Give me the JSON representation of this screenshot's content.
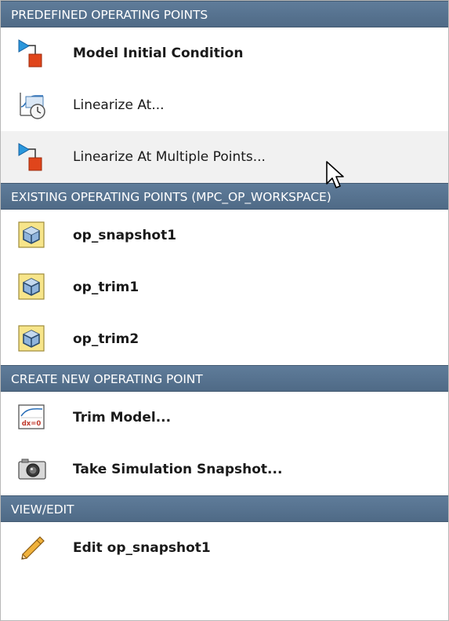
{
  "sections": [
    {
      "header": "PREDEFINED OPERATING POINTS",
      "items": [
        {
          "label": "Model Initial Condition",
          "icon": "model-block-icon"
        },
        {
          "label": "Linearize At...",
          "icon": "linearize-clock-icon"
        },
        {
          "label": "Linearize At Multiple Points...",
          "icon": "model-block-icon"
        }
      ]
    },
    {
      "header": "EXISTING OPERATING POINTS (MPC_OP_WORKSPACE)",
      "items": [
        {
          "label": "op_snapshot1",
          "icon": "operating-point-cube-icon"
        },
        {
          "label": "op_trim1",
          "icon": "operating-point-cube-icon"
        },
        {
          "label": "op_trim2",
          "icon": "operating-point-cube-icon"
        }
      ]
    },
    {
      "header": "CREATE NEW OPERATING POINT",
      "items": [
        {
          "label": "Trim Model...",
          "icon": "trim-dx0-icon",
          "icon_text": "dx=0"
        },
        {
          "label": "Take Simulation Snapshot...",
          "icon": "camera-icon"
        }
      ]
    },
    {
      "header": "VIEW/EDIT",
      "items": [
        {
          "label": "Edit op_snapshot1",
          "icon": "pencil-icon"
        }
      ]
    }
  ],
  "colors": {
    "header_bg": "#567391",
    "hover_bg": "#f1f1f1",
    "block_orange": "#e0451b",
    "triangle_blue": "#1f8fd6",
    "cube_bg": "#f7e58a"
  }
}
